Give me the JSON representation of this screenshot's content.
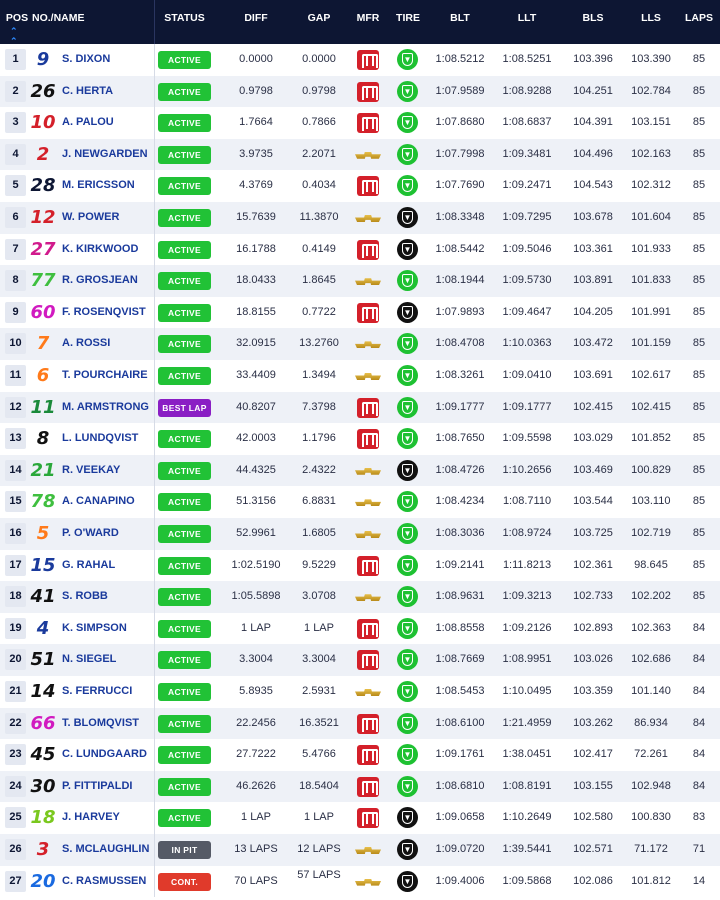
{
  "header": {
    "pos": "POS",
    "no_name": "NO./NAME",
    "status": "STATUS",
    "diff": "DIFF",
    "gap": "GAP",
    "mfr": "MFR",
    "tire": "TIRE",
    "blt": "BLT",
    "llt": "LLT",
    "bls": "BLS",
    "lls": "LLS",
    "laps": "LAPS",
    "sort_icon": "sort-up-icon"
  },
  "colors": {
    "header_bg": "#0d1633",
    "active": "#21c236",
    "best_lap": "#8a1ec4",
    "in_pit": "#555a66",
    "cont": "#e03a2b",
    "honda": "#d4202a",
    "tire_green": "#1ec132",
    "tire_black": "#111111"
  },
  "rows": [
    {
      "pos": "1",
      "num": "9",
      "num_color": "#1a3a9c",
      "name": "S. DIXON",
      "status": "ACTIVE",
      "status_type": "active",
      "diff": "0.0000",
      "gap": "0.0000",
      "mfr": "honda",
      "tire": "green",
      "blt": "1:08.5212",
      "llt": "1:08.5251",
      "bls": "103.396",
      "lls": "103.390",
      "laps": "85"
    },
    {
      "pos": "2",
      "num": "26",
      "num_color": "#111111",
      "name": "C. HERTA",
      "status": "ACTIVE",
      "status_type": "active",
      "diff": "0.9798",
      "gap": "0.9798",
      "mfr": "honda",
      "tire": "green",
      "blt": "1:07.9589",
      "llt": "1:08.9288",
      "bls": "104.251",
      "lls": "102.784",
      "laps": "85"
    },
    {
      "pos": "3",
      "num": "10",
      "num_color": "#d4202a",
      "name": "A. PALOU",
      "status": "ACTIVE",
      "status_type": "active",
      "diff": "1.7664",
      "gap": "0.7866",
      "mfr": "honda",
      "tire": "green",
      "blt": "1:07.8680",
      "llt": "1:08.6837",
      "bls": "104.391",
      "lls": "103.151",
      "laps": "85"
    },
    {
      "pos": "4",
      "num": "2",
      "num_color": "#d4202a",
      "name": "J. NEWGARDEN",
      "status": "ACTIVE",
      "status_type": "active",
      "diff": "3.9735",
      "gap": "2.2071",
      "mfr": "chevy",
      "tire": "green",
      "blt": "1:07.7998",
      "llt": "1:09.3481",
      "bls": "104.496",
      "lls": "102.163",
      "laps": "85"
    },
    {
      "pos": "5",
      "num": "28",
      "num_color": "#0d1633",
      "name": "M. ERICSSON",
      "status": "ACTIVE",
      "status_type": "active",
      "diff": "4.3769",
      "gap": "0.4034",
      "mfr": "honda",
      "tire": "green",
      "blt": "1:07.7690",
      "llt": "1:09.2471",
      "bls": "104.543",
      "lls": "102.312",
      "laps": "85"
    },
    {
      "pos": "6",
      "num": "12",
      "num_color": "#d4202a",
      "name": "W. POWER",
      "status": "ACTIVE",
      "status_type": "active",
      "diff": "15.7639",
      "gap": "11.3870",
      "mfr": "chevy",
      "tire": "black",
      "blt": "1:08.3348",
      "llt": "1:09.7295",
      "bls": "103.678",
      "lls": "101.604",
      "laps": "85"
    },
    {
      "pos": "7",
      "num": "27",
      "num_color": "#d11a8c",
      "name": "K. KIRKWOOD",
      "status": "ACTIVE",
      "status_type": "active",
      "diff": "16.1788",
      "gap": "0.4149",
      "mfr": "honda",
      "tire": "black",
      "blt": "1:08.5442",
      "llt": "1:09.5046",
      "bls": "103.361",
      "lls": "101.933",
      "laps": "85"
    },
    {
      "pos": "8",
      "num": "77",
      "num_color": "#3fbf3f",
      "name": "R. GROSJEAN",
      "status": "ACTIVE",
      "status_type": "active",
      "diff": "18.0433",
      "gap": "1.8645",
      "mfr": "chevy",
      "tire": "green",
      "blt": "1:08.1944",
      "llt": "1:09.5730",
      "bls": "103.891",
      "lls": "101.833",
      "laps": "85"
    },
    {
      "pos": "9",
      "num": "60",
      "num_color": "#d11ac0",
      "name": "F. ROSENQVIST",
      "status": "ACTIVE",
      "status_type": "active",
      "diff": "18.8155",
      "gap": "0.7722",
      "mfr": "honda",
      "tire": "black",
      "blt": "1:07.9893",
      "llt": "1:09.4647",
      "bls": "104.205",
      "lls": "101.991",
      "laps": "85"
    },
    {
      "pos": "10",
      "num": "7",
      "num_color": "#ff7a1a",
      "name": "A. ROSSI",
      "status": "ACTIVE",
      "status_type": "active",
      "diff": "32.0915",
      "gap": "13.2760",
      "mfr": "chevy",
      "tire": "green",
      "blt": "1:08.4708",
      "llt": "1:10.0363",
      "bls": "103.472",
      "lls": "101.159",
      "laps": "85"
    },
    {
      "pos": "11",
      "num": "6",
      "num_color": "#ff7a1a",
      "name": "T. POURCHAIRE",
      "status": "ACTIVE",
      "status_type": "active",
      "diff": "33.4409",
      "gap": "1.3494",
      "mfr": "chevy",
      "tire": "green",
      "blt": "1:08.3261",
      "llt": "1:09.0410",
      "bls": "103.691",
      "lls": "102.617",
      "laps": "85"
    },
    {
      "pos": "12",
      "num": "11",
      "num_color": "#1a8a3a",
      "name": "M. ARMSTRONG",
      "status": "BEST LAP",
      "status_type": "best",
      "diff": "40.8207",
      "gap": "7.3798",
      "mfr": "honda",
      "tire": "green",
      "blt": "1:09.1777",
      "llt": "1:09.1777",
      "bls": "102.415",
      "lls": "102.415",
      "laps": "85"
    },
    {
      "pos": "13",
      "num": "8",
      "num_color": "#111111",
      "name": "L. LUNDQVIST",
      "status": "ACTIVE",
      "status_type": "active",
      "diff": "42.0003",
      "gap": "1.1796",
      "mfr": "honda",
      "tire": "green",
      "blt": "1:08.7650",
      "llt": "1:09.5598",
      "bls": "103.029",
      "lls": "101.852",
      "laps": "85"
    },
    {
      "pos": "14",
      "num": "21",
      "num_color": "#2aa83a",
      "name": "R. VEEKAY",
      "status": "ACTIVE",
      "status_type": "active",
      "diff": "44.4325",
      "gap": "2.4322",
      "mfr": "chevy",
      "tire": "black",
      "blt": "1:08.4726",
      "llt": "1:10.2656",
      "bls": "103.469",
      "lls": "100.829",
      "laps": "85"
    },
    {
      "pos": "15",
      "num": "78",
      "num_color": "#3fbf3f",
      "name": "A. CANAPINO",
      "status": "ACTIVE",
      "status_type": "active",
      "diff": "51.3156",
      "gap": "6.8831",
      "mfr": "chevy",
      "tire": "green",
      "blt": "1:08.4234",
      "llt": "1:08.7110",
      "bls": "103.544",
      "lls": "103.110",
      "laps": "85"
    },
    {
      "pos": "16",
      "num": "5",
      "num_color": "#ff7a1a",
      "name": "P. O'WARD",
      "status": "ACTIVE",
      "status_type": "active",
      "diff": "52.9961",
      "gap": "1.6805",
      "mfr": "chevy",
      "tire": "green",
      "blt": "1:08.3036",
      "llt": "1:08.9724",
      "bls": "103.725",
      "lls": "102.719",
      "laps": "85"
    },
    {
      "pos": "17",
      "num": "15",
      "num_color": "#1a3a9c",
      "name": "G. RAHAL",
      "status": "ACTIVE",
      "status_type": "active",
      "diff": "1:02.5190",
      "gap": "9.5229",
      "mfr": "honda",
      "tire": "green",
      "blt": "1:09.2141",
      "llt": "1:11.8213",
      "bls": "102.361",
      "lls": "98.645",
      "laps": "85"
    },
    {
      "pos": "18",
      "num": "41",
      "num_color": "#111111",
      "name": "S. ROBB",
      "status": "ACTIVE",
      "status_type": "active",
      "diff": "1:05.5898",
      "gap": "3.0708",
      "mfr": "chevy",
      "tire": "green",
      "blt": "1:08.9631",
      "llt": "1:09.3213",
      "bls": "102.733",
      "lls": "102.202",
      "laps": "85"
    },
    {
      "pos": "19",
      "num": "4",
      "num_color": "#1a3a9c",
      "name": "K. SIMPSON",
      "status": "ACTIVE",
      "status_type": "active",
      "diff": "1 LAP",
      "gap": "1 LAP",
      "mfr": "honda",
      "tire": "green",
      "blt": "1:08.8558",
      "llt": "1:09.2126",
      "bls": "102.893",
      "lls": "102.363",
      "laps": "84"
    },
    {
      "pos": "20",
      "num": "51",
      "num_color": "#111111",
      "name": "N. SIEGEL",
      "status": "ACTIVE",
      "status_type": "active",
      "diff": "3.3004",
      "gap": "3.3004",
      "mfr": "honda",
      "tire": "green",
      "blt": "1:08.7669",
      "llt": "1:08.9951",
      "bls": "103.026",
      "lls": "102.686",
      "laps": "84"
    },
    {
      "pos": "21",
      "num": "14",
      "num_color": "#111111",
      "name": "S. FERRUCCI",
      "status": "ACTIVE",
      "status_type": "active",
      "diff": "5.8935",
      "gap": "2.5931",
      "mfr": "chevy",
      "tire": "green",
      "blt": "1:08.5453",
      "llt": "1:10.0495",
      "bls": "103.359",
      "lls": "101.140",
      "laps": "84"
    },
    {
      "pos": "22",
      "num": "66",
      "num_color": "#d11ac0",
      "name": "T. BLOMQVIST",
      "status": "ACTIVE",
      "status_type": "active",
      "diff": "22.2456",
      "gap": "16.3521",
      "mfr": "honda",
      "tire": "green",
      "blt": "1:08.6100",
      "llt": "1:21.4959",
      "bls": "103.262",
      "lls": "86.934",
      "laps": "84"
    },
    {
      "pos": "23",
      "num": "45",
      "num_color": "#111111",
      "name": "C. LUNDGAARD",
      "status": "ACTIVE",
      "status_type": "active",
      "diff": "27.7222",
      "gap": "5.4766",
      "mfr": "honda",
      "tire": "green",
      "blt": "1:09.1761",
      "llt": "1:38.0451",
      "bls": "102.417",
      "lls": "72.261",
      "laps": "84"
    },
    {
      "pos": "24",
      "num": "30",
      "num_color": "#111111",
      "name": "P. FITTIPALDI",
      "status": "ACTIVE",
      "status_type": "active",
      "diff": "46.2626",
      "gap": "18.5404",
      "mfr": "honda",
      "tire": "green",
      "blt": "1:08.6810",
      "llt": "1:08.8191",
      "bls": "103.155",
      "lls": "102.948",
      "laps": "84"
    },
    {
      "pos": "25",
      "num": "18",
      "num_color": "#7ac81e",
      "name": "J. HARVEY",
      "status": "ACTIVE",
      "status_type": "active",
      "diff": "1 LAP",
      "gap": "1 LAP",
      "mfr": "honda",
      "tire": "black",
      "blt": "1:09.0658",
      "llt": "1:10.2649",
      "bls": "102.580",
      "lls": "100.830",
      "laps": "83"
    },
    {
      "pos": "26",
      "num": "3",
      "num_color": "#d4202a",
      "name": "S. MCLAUGHLIN",
      "status": "IN PIT",
      "status_type": "pit",
      "diff": "13 LAPS",
      "gap": "12 LAPS",
      "mfr": "chevy",
      "tire": "black",
      "blt": "1:09.0720",
      "llt": "1:39.5441",
      "bls": "102.571",
      "lls": "71.172",
      "laps": "71"
    },
    {
      "pos": "27",
      "num": "20",
      "num_color": "#1a6ae0",
      "name": "C. RASMUSSEN",
      "status": "CONT.",
      "status_type": "cont",
      "diff": "70 LAPS",
      "gap": "57 LAPS",
      "mfr": "chevy",
      "tire": "black",
      "blt": "1:09.4006",
      "llt": "1:09.5868",
      "bls": "102.086",
      "lls": "101.812",
      "laps": "14"
    }
  ]
}
